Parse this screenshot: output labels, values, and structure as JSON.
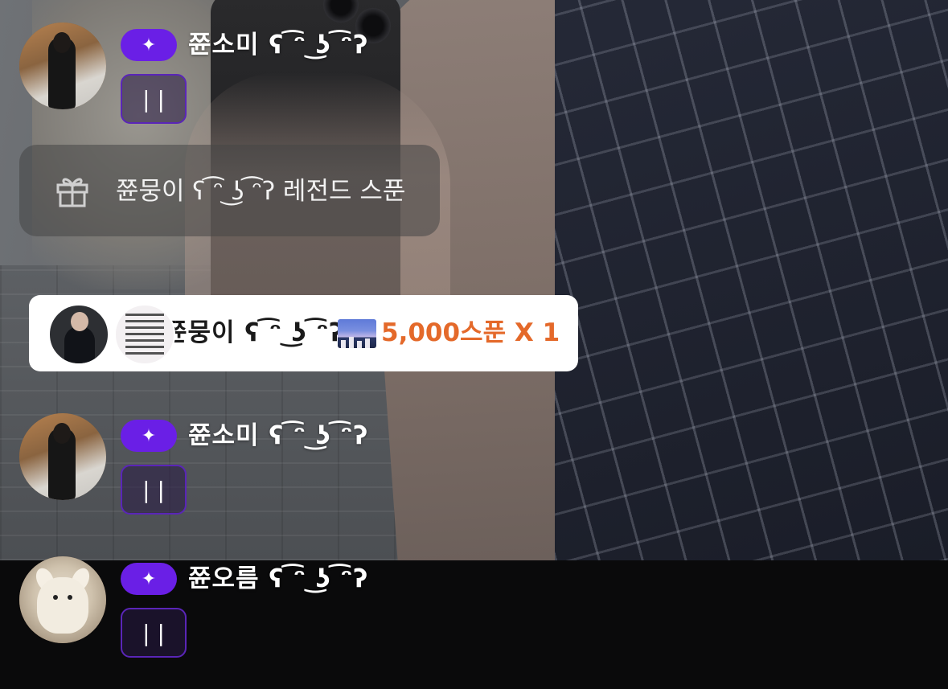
{
  "messages": [
    {
      "username": "쮼소미 ʕ ͡ᵔ ͜ʖ ͡ᵔʔ",
      "badge_icon": "sparkle-icon",
      "text": "| |"
    },
    {
      "username": "쮼소미 ʕ ͡ᵔ ͜ʖ ͡ᵔʔ",
      "badge_icon": "sparkle-icon",
      "text": "| |"
    },
    {
      "username": "쮼오름 ʕ ͡ᵔ ͜ʖ ͡ᵔʔ",
      "badge_icon": "sparkle-icon",
      "text": "| |"
    }
  ],
  "legend_banner": {
    "icon": "gift-icon",
    "text": "쮼뭉이 ʕ ͡ᵔ ͜ʖ ͡ᵔʔ 레전드 스푼"
  },
  "gift_card": {
    "sender": "쮼뭉이 ʕ ͡ᵔ ͜ʖ ͡ᵔʔ",
    "sticker_icon": "city-night-sticker-icon",
    "amount": "5,000스푼 X 1",
    "amount_color": "#e4692a"
  },
  "colors": {
    "badge": "#6a1fe6",
    "bubble_border": "#5a25b8"
  }
}
